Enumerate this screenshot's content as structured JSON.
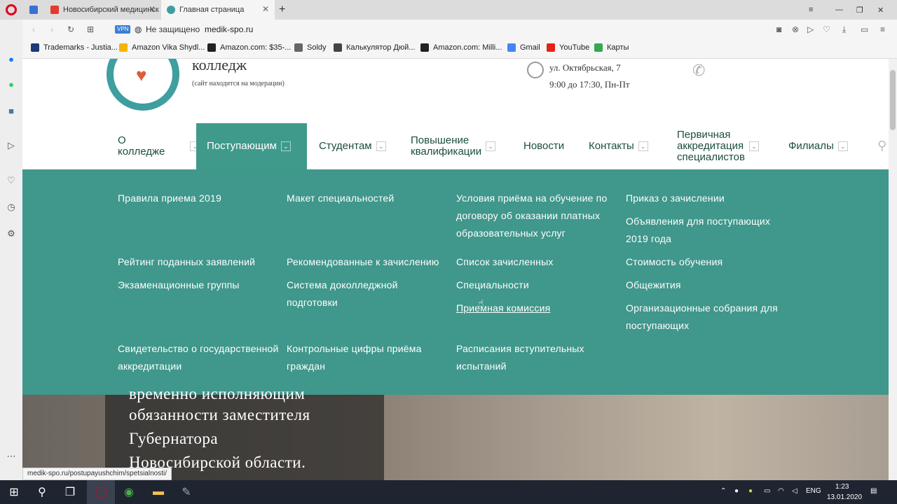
{
  "browser": {
    "tabs": [
      {
        "label": "Новосибирский медицинск",
        "active": false
      },
      {
        "label": "Главная страница",
        "active": true
      }
    ],
    "new_tab": "+",
    "vpn": "VPN",
    "security": "Не защищено",
    "url": "medik-spo.ru",
    "bookmarks": [
      "Trademarks - Justia...",
      "Amazon Vika Shydl...",
      "Amazon.com: $35-...",
      "Soldy",
      "Калькулятор Дюй...",
      "Amazon.com: Milli...",
      "Gmail",
      "YouTube",
      "Карты"
    ],
    "status_url": "medik-spo.ru/postupayushchim/spetsialnosti/"
  },
  "header": {
    "college_word": "колледж",
    "moderation_note": "(сайт находится на модерации)",
    "address": "ул. Октябрьская, 7",
    "hours": "9:00 до 17:30, Пн-Пт",
    "logo_text": "НОВОСИБИРСКИЙ МЕДИЦИНСКИЙ КОЛЛЕДЖ"
  },
  "nav": {
    "items": [
      {
        "l1": "О",
        "l2": "колледже"
      },
      {
        "l1": "Поступающим"
      },
      {
        "l1": "Студентам"
      },
      {
        "l1": "Повышение",
        "l2": "квалификации"
      },
      {
        "l1": "Новости"
      },
      {
        "l1": "Контакты"
      },
      {
        "l1": "Первичная",
        "l2": "аккредитация",
        "l3": "специалистов"
      },
      {
        "l1": "Филиалы"
      }
    ],
    "dropdown_glyph": "⌄"
  },
  "mega": {
    "links": [
      [
        "Правила приема 2019"
      ],
      [
        "Макет специальностей"
      ],
      [
        "Условия приёма на обучение по",
        "договору об оказании платных",
        "образовательных услуг"
      ],
      [
        "Приказ о зачислении"
      ],
      [
        "Объявления для поступающих",
        "2019 года"
      ],
      [
        "Рейтинг поданных заявлений"
      ],
      [
        "Рекомендованные к зачислению"
      ],
      [
        "Список зачисленных"
      ],
      [
        "Стоимость обучения"
      ],
      [
        "Экзаменационные группы"
      ],
      [
        "Система доколледжной",
        "подготовки"
      ],
      [
        "Специальности"
      ],
      [
        "Общежития"
      ],
      [
        "Приемная комиссия"
      ],
      [
        "Организационные собрания для",
        "поступающих"
      ],
      [
        "Свидетельство о государственной",
        "аккредитации"
      ],
      [
        "Контрольные цифры приёма",
        "граждан"
      ],
      [
        "Расписания вступительных",
        "испытаний"
      ]
    ]
  },
  "hero": {
    "lines": [
      "временно исполняющим",
      "обязанности заместителя",
      "Губернатора",
      "Новосибирской области."
    ]
  },
  "taskbar": {
    "lang": "ENG",
    "time": "1:23",
    "date": "13.01.2020"
  }
}
